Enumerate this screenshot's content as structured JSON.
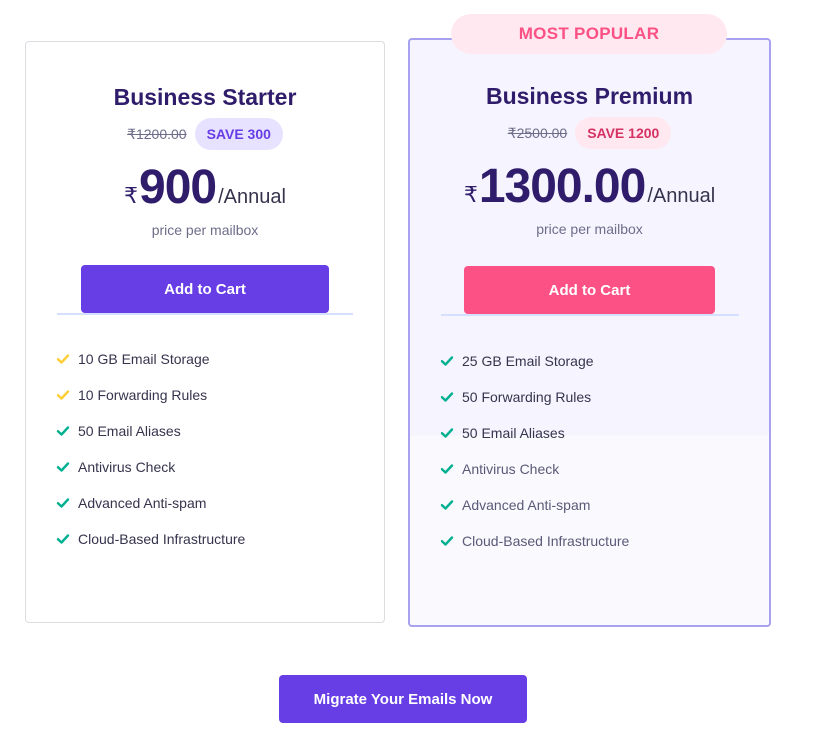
{
  "plans": [
    {
      "title": "Business Starter",
      "old_price": "₹1200.00",
      "save_label": "SAVE 300",
      "currency": "₹",
      "price": "900",
      "period": "/Annual",
      "price_note": "price per mailbox",
      "cart_label": "Add to Cart",
      "features": [
        {
          "text": "10 GB Email Storage",
          "check": "yellow"
        },
        {
          "text": "10 Forwarding Rules",
          "check": "yellow"
        },
        {
          "text": "50 Email Aliases",
          "check": "green"
        },
        {
          "text": "Antivirus Check",
          "check": "green"
        },
        {
          "text": "Advanced Anti-spam",
          "check": "green"
        },
        {
          "text": "Cloud-Based Infrastructure",
          "check": "green"
        }
      ]
    },
    {
      "badge": "MOST POPULAR",
      "title": "Business Premium",
      "old_price": "₹2500.00",
      "save_label": "SAVE 1200",
      "currency": "₹",
      "price": "1300.00",
      "period": "/Annual",
      "price_note": "price per mailbox",
      "cart_label": "Add to Cart",
      "features": [
        {
          "text": "25 GB Email Storage",
          "check": "green"
        },
        {
          "text": "50 Forwarding Rules",
          "check": "green"
        },
        {
          "text": "50 Email Aliases",
          "check": "green"
        },
        {
          "text": "Antivirus Check",
          "check": "green"
        },
        {
          "text": "Advanced Anti-spam",
          "check": "green"
        },
        {
          "text": "Cloud-Based Infrastructure",
          "check": "green"
        }
      ]
    }
  ],
  "migrate_label": "Migrate Your Emails Now",
  "colors": {
    "primary": "#673de6",
    "accent_pink": "#fc5185",
    "check_green": "#00b090",
    "check_yellow": "#ffcd35",
    "heading": "#2f1c6a"
  }
}
